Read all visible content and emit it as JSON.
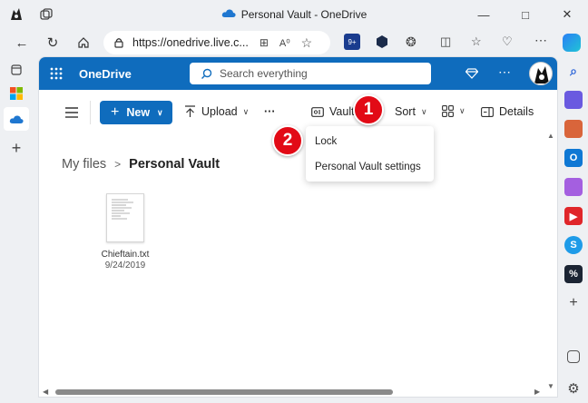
{
  "window": {
    "title": "Personal Vault - OneDrive",
    "controls": [
      "minimize",
      "maximize",
      "close"
    ]
  },
  "browser": {
    "url": "https://onedrive.live.c...",
    "nav_icons": [
      "back-icon",
      "refresh-icon",
      "home-icon"
    ]
  },
  "app": {
    "name": "OneDrive",
    "search_placeholder": "Search everything",
    "colors": {
      "brand": "#0f6cbd",
      "callout": "#e20a16"
    }
  },
  "commandbar": {
    "new_label": "New",
    "upload_label": "Upload",
    "more_label": "···",
    "vault_label": "Vault",
    "sort_label": "Sort",
    "details_label": "Details"
  },
  "breadcrumb": {
    "root": "My files",
    "separator": ">",
    "current": "Personal Vault"
  },
  "files": [
    {
      "name": "Chieftain.txt",
      "date": "9/24/2019"
    }
  ],
  "vault_menu": {
    "items": [
      {
        "label": "Lock"
      },
      {
        "label": "Personal Vault settings"
      }
    ]
  },
  "callouts": [
    "1",
    "2"
  ]
}
